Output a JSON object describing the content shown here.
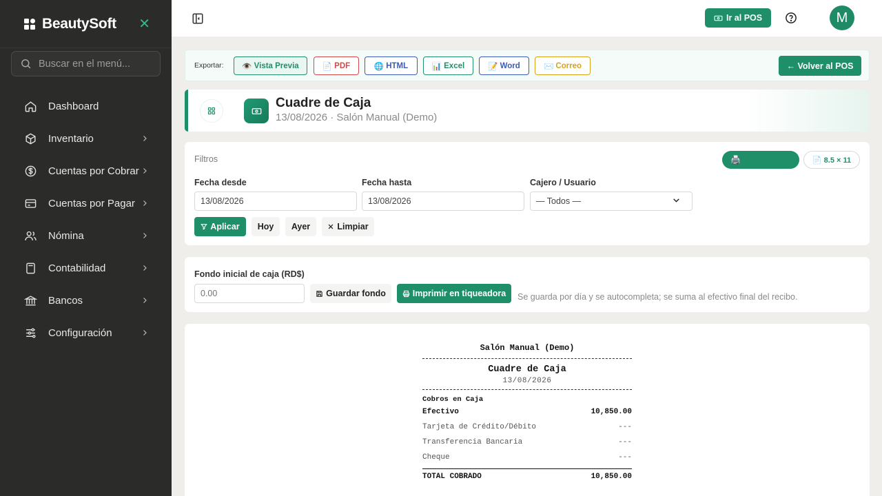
{
  "brand": {
    "name": "BeautySoft",
    "close_glyph": "✕"
  },
  "sidebar": {
    "search_placeholder": "Buscar en el menú...",
    "items": [
      {
        "label": "Dashboard",
        "icon": "home-icon",
        "has_children": false
      },
      {
        "label": "Inventario",
        "icon": "box-icon",
        "has_children": true
      },
      {
        "label": "Cuentas por Cobrar",
        "icon": "dollar-circle-icon",
        "has_children": true
      },
      {
        "label": "Cuentas por Pagar",
        "icon": "credit-card-icon",
        "has_children": true
      },
      {
        "label": "Nómina",
        "icon": "users-icon",
        "has_children": true
      },
      {
        "label": "Contabilidad",
        "icon": "calculator-icon",
        "has_children": true
      },
      {
        "label": "Bancos",
        "icon": "bank-icon",
        "has_children": true
      },
      {
        "label": "Configuración",
        "icon": "sliders-icon",
        "has_children": true
      }
    ]
  },
  "topbar": {
    "pos_label": "Ir al POS",
    "avatar_initial": "M"
  },
  "export": {
    "label": "Exportar:",
    "buttons": [
      {
        "label": "Vista Previa",
        "icon": "👁️",
        "color": "#1f8f6a"
      },
      {
        "label": "PDF",
        "icon": "📄",
        "color": "#d04a4a"
      },
      {
        "label": "HTML",
        "icon": "🌐",
        "color": "#3a5bb8"
      },
      {
        "label": "Excel",
        "icon": "📊",
        "color": "#1f8f6a"
      },
      {
        "label": "Word",
        "icon": "📝",
        "color": "#3a5bb8"
      },
      {
        "label": "Correo",
        "icon": "✉️",
        "color": "#d9a21b"
      }
    ],
    "back_label": "← Volver al POS"
  },
  "header": {
    "title": "Cuadre de Caja",
    "subtitle": "13/08/2026 · Salón Manual (Demo)"
  },
  "filters": {
    "title": "Filtros",
    "print_icon": "🖨️",
    "paper_label": "📄 8.5 × 11",
    "date_from_label": "Fecha desde",
    "date_from_value": "13/08/2026",
    "date_to_label": "Fecha hasta",
    "date_to_value": "13/08/2026",
    "cashier_label": "Cajero / Usuario",
    "cashier_value": "— Todos —",
    "apply_label": "Aplicar",
    "today_label": "Hoy",
    "yesterday_label": "Ayer",
    "clear_label": "Limpiar"
  },
  "fondo": {
    "label": "Fondo inicial de caja (RD$)",
    "placeholder": "0.00",
    "save_label": "Guardar fondo",
    "print_label": "Imprimir en tiqueadora",
    "hint": "Se guarda por día y se autocompleta; se suma al efectivo final del recibo."
  },
  "receipt": {
    "business": "Salón Manual (Demo)",
    "title": "Cuadre de Caja",
    "date": "13/08/2026",
    "section": "Cobros en Caja",
    "rows": [
      {
        "label": "Efectivo",
        "value": "10,850.00",
        "style": "bold"
      },
      {
        "label": "Tarjeta de Crédito/Débito",
        "value": "---",
        "style": "muted"
      },
      {
        "label": "Transferencia Bancaria",
        "value": "---",
        "style": "muted"
      },
      {
        "label": "Cheque",
        "value": "---",
        "style": "muted"
      }
    ],
    "total_label": "TOTAL COBRADO",
    "total_value": "10,850.00"
  },
  "colors": {
    "accent": "#1f8f6a",
    "sidebar_bg": "#2b2b2a",
    "page_bg": "#efeeeb"
  }
}
